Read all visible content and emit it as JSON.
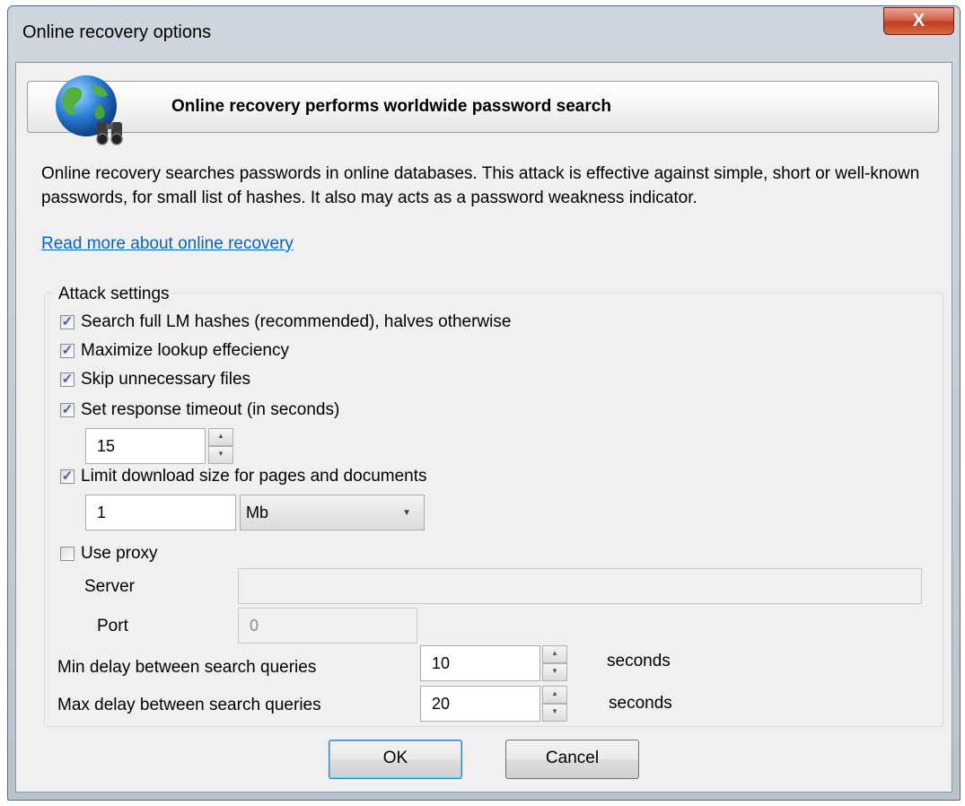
{
  "window": {
    "title": "Online recovery options",
    "close_label": "X"
  },
  "banner": {
    "title": "Online recovery performs worldwide password search",
    "icon": "globe-binoculars-icon"
  },
  "description": "Online recovery searches passwords in online databases. This attack is effective against simple, short or well-known passwords, for small list of hashes. It also may acts as a password weakness indicator.",
  "link": "Read more about online recovery",
  "attack_settings": {
    "title": "Attack settings",
    "search_full_lm": {
      "label": "Search full LM hashes (recommended), halves otherwise",
      "checked": true
    },
    "maximize_lookup": {
      "label": "Maximize lookup effeciency",
      "checked": true
    },
    "skip_files": {
      "label": "Skip unnecessary files",
      "checked": true
    },
    "response_timeout": {
      "label": "Set response timeout (in seconds)",
      "checked": true,
      "value": "15"
    },
    "limit_download": {
      "label": "Limit download size for pages and documents",
      "checked": true,
      "value": "1",
      "unit": "Mb"
    },
    "use_proxy": {
      "label": "Use proxy",
      "checked": false
    },
    "server": {
      "label": "Server",
      "value": ""
    },
    "port": {
      "label": "Port",
      "value": "0"
    },
    "min_delay": {
      "label": "Min delay between search queries",
      "value": "10",
      "unit": "seconds"
    },
    "max_delay": {
      "label": "Max delay between search queries",
      "value": "20",
      "unit": "seconds"
    }
  },
  "buttons": {
    "ok": "OK",
    "cancel": "Cancel"
  },
  "colors": {
    "link": "#0066cc",
    "close_button": "#c13b1e",
    "check_mark": "#4a5f97"
  }
}
